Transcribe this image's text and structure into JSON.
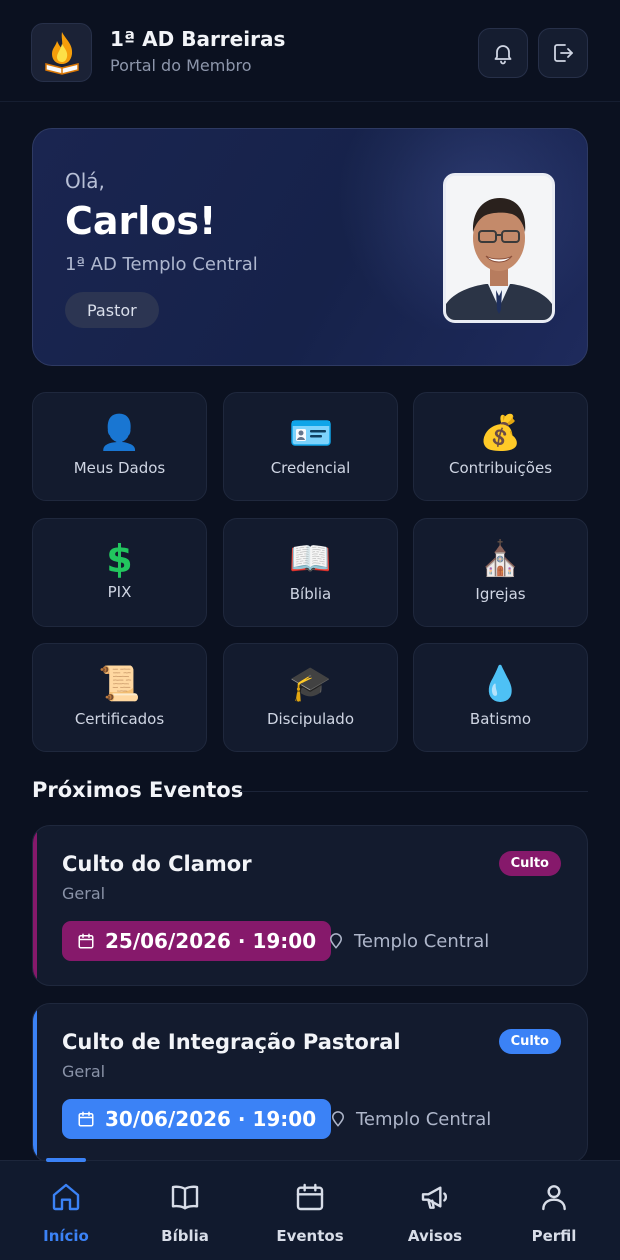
{
  "header": {
    "title": "1ª AD Barreiras",
    "subtitle": "Portal do Membro",
    "logo_icon": "flame-bible-icon",
    "actions": [
      {
        "icon": "bell-icon"
      },
      {
        "icon": "logout-icon"
      }
    ]
  },
  "greeting": {
    "hello": "Olá,",
    "name": "Carlos!",
    "church": "1ª AD Templo Central",
    "role": "Pastor"
  },
  "menu": [
    {
      "label": "Meus Dados",
      "icon": "person-icon",
      "glyph": "👤"
    },
    {
      "label": "Credencial",
      "icon": "id-card-icon",
      "glyph": "🪪"
    },
    {
      "label": "Contribuições",
      "icon": "money-bag-icon",
      "glyph": "💰"
    },
    {
      "label": "PIX",
      "icon": "dollar-sign-icon",
      "glyph": "💲"
    },
    {
      "label": "Bíblia",
      "icon": "open-book-icon",
      "glyph": "📖"
    },
    {
      "label": "Igrejas",
      "icon": "church-icon",
      "glyph": "⛪"
    },
    {
      "label": "Certificados",
      "icon": "scroll-icon",
      "glyph": "📜"
    },
    {
      "label": "Discipulado",
      "icon": "graduation-cap-icon",
      "glyph": "🎓"
    },
    {
      "label": "Batismo",
      "icon": "water-drop-icon",
      "glyph": "💧"
    }
  ],
  "events_section": {
    "title": "Próximos Eventos",
    "events": [
      {
        "title": "Culto do Clamor",
        "category": "Geral",
        "tag": "Culto",
        "datetime": "25/06/2026 · 19:00",
        "location": "Templo Central",
        "color": "#86196b"
      },
      {
        "title": "Culto de Integração Pastoral",
        "category": "Geral",
        "tag": "Culto",
        "datetime": "30/06/2026 · 19:00",
        "location": "Templo Central",
        "color": "#3b82f6"
      }
    ]
  },
  "nav": {
    "active": "Início",
    "active_color": "#3b82f6",
    "items": [
      {
        "label": "Início",
        "icon": "home-icon"
      },
      {
        "label": "Bíblia",
        "icon": "book-icon"
      },
      {
        "label": "Eventos",
        "icon": "calendar-icon"
      },
      {
        "label": "Avisos",
        "icon": "megaphone-icon"
      },
      {
        "label": "Perfil",
        "icon": "user-icon"
      }
    ]
  }
}
